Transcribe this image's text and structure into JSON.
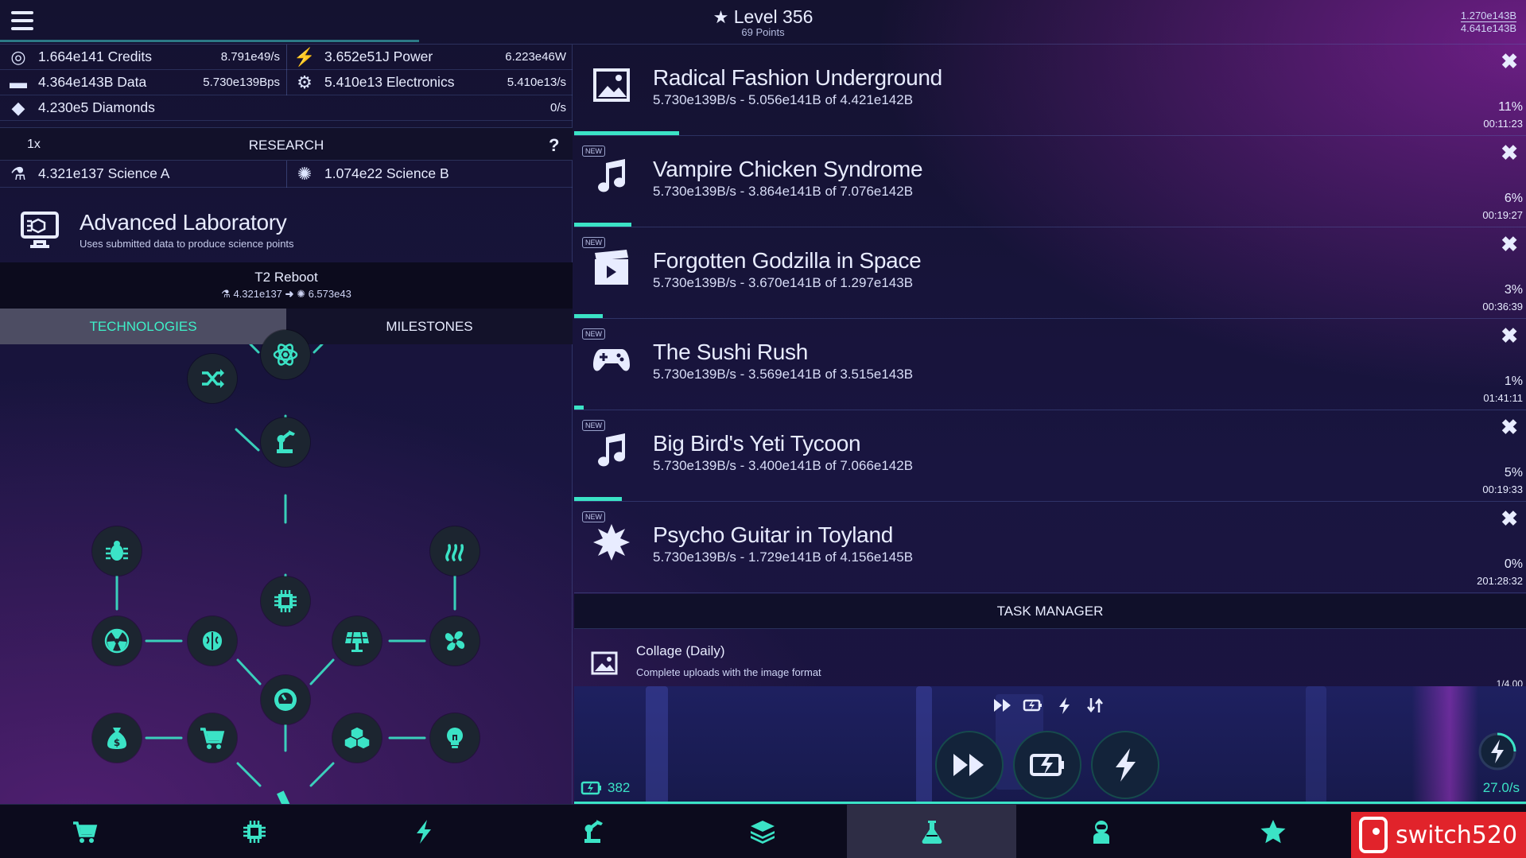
{
  "header": {
    "level": "Level 356",
    "points": "69 Points",
    "corner_top": "1.270e143B",
    "corner_bottom": "4.641e143B"
  },
  "resources": {
    "credits": {
      "label": "1.664e141 Credits",
      "rate": "8.791e49/s"
    },
    "power": {
      "label": "3.652e51J Power",
      "rate": "6.223e46W"
    },
    "data": {
      "label": "4.364e143B Data",
      "rate": "5.730e139Bps"
    },
    "electronics": {
      "label": "5.410e13 Electronics",
      "rate": "5.410e13/s"
    },
    "diamonds": {
      "label": "4.230e5 Diamonds",
      "rate": "0/s"
    }
  },
  "research": {
    "multiplier": "1x",
    "title": "RESEARCH",
    "help": "?",
    "science_a": "4.321e137 Science A",
    "science_b": "1.074e22 Science B"
  },
  "lab": {
    "title": "Advanced Laboratory",
    "subtitle": "Uses submitted data to produce science points"
  },
  "reboot": {
    "title": "T2 Reboot",
    "from": "4.321e137",
    "to": "6.573e43"
  },
  "tabs": {
    "technologies": "TECHNOLOGIES",
    "milestones": "MILESTONES"
  },
  "tree_icons": [
    "atom-icon",
    "shuffle-icon",
    "robot-arm-icon",
    "bug-icon",
    "fire-icon",
    "radiation-icon",
    "brain-icon",
    "chip-icon",
    "solar-panel-icon",
    "fan-icon",
    "money-bag-icon",
    "cart-icon",
    "dial-icon",
    "cubes-icon",
    "lightbulb-icon",
    "microscope-icon"
  ],
  "uploads": [
    {
      "name": "Radical Fashion Underground",
      "detail": "5.730e139B/s - 5.056e141B of 4.421e142B",
      "percent": "11%",
      "time": "00:11:23",
      "progress": 0.11,
      "is_new": false,
      "type_icon": "image-icon"
    },
    {
      "name": "Vampire Chicken Syndrome",
      "detail": "5.730e139B/s - 3.864e141B of 7.076e142B",
      "percent": "6%",
      "time": "00:19:27",
      "progress": 0.06,
      "is_new": true,
      "type_icon": "music-icon"
    },
    {
      "name": "Forgotten Godzilla in Space",
      "detail": "5.730e139B/s - 3.670e141B of 1.297e143B",
      "percent": "3%",
      "time": "00:36:39",
      "progress": 0.03,
      "is_new": true,
      "type_icon": "video-icon"
    },
    {
      "name": "The Sushi Rush",
      "detail": "5.730e139B/s - 3.569e141B of 3.515e143B",
      "percent": "1%",
      "time": "01:41:11",
      "progress": 0.01,
      "is_new": true,
      "type_icon": "gamepad-icon"
    },
    {
      "name": "Big Bird's Yeti Tycoon",
      "detail": "5.730e139B/s - 3.400e141B of 7.066e142B",
      "percent": "5%",
      "time": "00:19:33",
      "progress": 0.05,
      "is_new": true,
      "type_icon": "music-icon"
    },
    {
      "name": "Psycho Guitar in Toyland",
      "detail": "5.730e139B/s - 1.729e141B of 4.156e145B",
      "percent": "0%",
      "time": "201:28:32",
      "progress": 0.0,
      "is_new": true,
      "type_icon": "burst-icon"
    }
  ],
  "new_badge": "NEW",
  "close_glyph": "✖",
  "task_manager": {
    "title": "TASK MANAGER",
    "task_name": "Collage (Daily)",
    "task_desc": "Complete uploads with the image format",
    "task_amount": "1/4.00"
  },
  "boost": {
    "charges": "382",
    "rate": "27.0/s"
  },
  "nav_icons": [
    "cart-icon",
    "chip-icon",
    "bolt-icon",
    "robot-arm-icon",
    "layers-icon",
    "flask-icon",
    "astronaut-icon",
    "star-icon"
  ],
  "active_nav": 5,
  "logo_text": "switch520",
  "colors": {
    "accent": "#3be3c6",
    "bg": "#191540",
    "tab_active": "#4d4d63",
    "logo": "#e1232b"
  }
}
